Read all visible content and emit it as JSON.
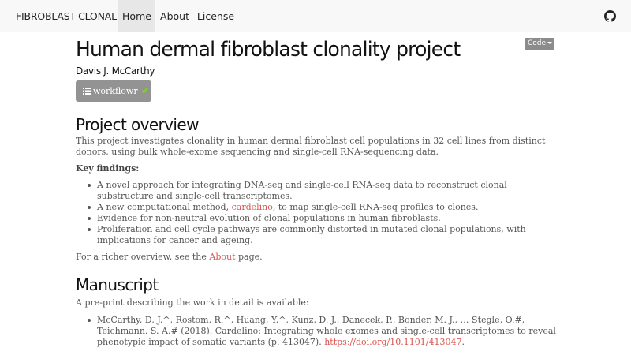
{
  "nav": {
    "brand": "FIBROBLAST-CLONALITY",
    "items": [
      {
        "label": "Home",
        "active": true
      },
      {
        "label": "About",
        "active": false
      },
      {
        "label": "License",
        "active": false
      }
    ],
    "github_icon": "github-icon"
  },
  "code_button": {
    "label": "Code"
  },
  "header": {
    "title": "Human dermal fibroblast clonality project",
    "author": "Davis J. McCarthy",
    "workflowr_label": "workflowr",
    "workflowr_status_icon": "check-icon"
  },
  "overview": {
    "heading": "Project overview",
    "intro": "This project investigates clonality in human dermal fibroblast cell populations in 32 cell lines from distinct donors, using bulk whole-exome sequencing and single-cell RNA-sequencing data.",
    "key_findings_label": "Key findings:",
    "findings": [
      {
        "text": "A novel approach for integrating DNA-seq and single-cell RNA-seq data to reconstruct clonal substructure and single-cell transcriptomes."
      },
      {
        "pre": "A new computational method, ",
        "link": "cardelino",
        "post": ", to map single-cell RNA-seq profiles to clones."
      },
      {
        "text": "Evidence for non-neutral evolution of clonal populations in human fibroblasts."
      },
      {
        "text": "Proliferation and cell cycle pathways are commonly distorted in mutated clonal populations, with implications for cancer and ageing."
      }
    ],
    "richer_pre": "For a richer overview, see the ",
    "richer_link": "About",
    "richer_post": " page."
  },
  "manuscript": {
    "heading": "Manuscript",
    "intro": "A pre-print describing the work in detail is available:",
    "ref_text": "McCarthy, D. J.^, Rostom, R.^, Huang, Y.^, Kunz, D. J., Danecek, P., Bonder, M. J., … Stegle, O.#, Teichmann, S. A.# (2018). Cardelino: Integrating whole exomes and single-cell transcriptomes to reveal phenotypic impact of somatic variants (p. 413047). ",
    "ref_link": "https://doi.org/10.1101/413047",
    "ref_post": "."
  },
  "colors": {
    "link": "#d9534f",
    "navbar_bg": "#f8f8f8",
    "button_grey": "#939393",
    "check_green": "#7ed321"
  }
}
